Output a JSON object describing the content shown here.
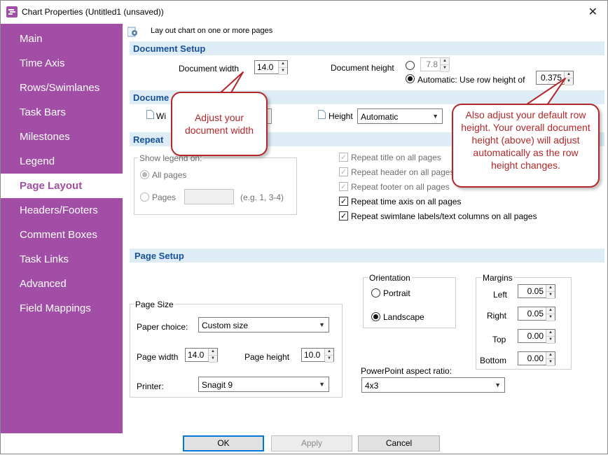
{
  "window": {
    "title": "Chart Properties (Untitled1 (unsaved))",
    "close_label": "✕"
  },
  "sidebar": {
    "items": [
      {
        "label": "Main"
      },
      {
        "label": "Time Axis"
      },
      {
        "label": "Rows/Swimlanes"
      },
      {
        "label": "Task Bars"
      },
      {
        "label": "Milestones"
      },
      {
        "label": "Legend"
      },
      {
        "label": "Page Layout"
      },
      {
        "label": "Headers/Footers"
      },
      {
        "label": "Comment Boxes"
      },
      {
        "label": "Task Links"
      },
      {
        "label": "Advanced"
      },
      {
        "label": "Field Mappings"
      }
    ],
    "active": "Page Layout"
  },
  "header": {
    "description": "Lay out chart on one or more pages"
  },
  "document_setup": {
    "title": "Document Setup",
    "width_label": "Document width",
    "width_value": "14.0",
    "height_label": "Document height",
    "height_value": "7.8",
    "auto_label": "Automatic: Use row height of",
    "row_height_value": "0.375"
  },
  "document_section": {
    "title_visible": "Docume",
    "width_label_visible": "Wi",
    "height_label": "Height",
    "height_select": "Automatic"
  },
  "repeat_section": {
    "title_visible": "Repeat",
    "show_legend_label": "Show legend on:",
    "all_pages_label": "All pages",
    "pages_label": "Pages",
    "pages_hint": "(e.g. 1, 3-4)",
    "options": [
      {
        "label": "Repeat title on all pages",
        "checked": true,
        "disabled": true
      },
      {
        "label": "Repeat header on all pages",
        "checked": true,
        "disabled": true
      },
      {
        "label": "Repeat footer on all pages",
        "checked": true,
        "disabled": true
      },
      {
        "label": "Repeat time axis on all pages",
        "checked": true,
        "disabled": false
      },
      {
        "label": "Repeat swimlane labels/text columns on all pages",
        "checked": true,
        "disabled": false
      }
    ]
  },
  "page_setup": {
    "title": "Page Setup",
    "page_size_title": "Page Size",
    "paper_choice_label": "Paper choice:",
    "paper_choice_value": "Custom size",
    "page_width_label": "Page width",
    "page_width_value": "14.0",
    "page_height_label": "Page height",
    "page_height_value": "10.0",
    "printer_label": "Printer:",
    "printer_value": "Snagit 9",
    "orientation_title": "Orientation",
    "portrait_label": "Portrait",
    "landscape_label": "Landscape",
    "margins_title": "Margins",
    "margins": [
      {
        "label": "Left",
        "value": "0.05"
      },
      {
        "label": "Right",
        "value": "0.05"
      },
      {
        "label": "Top",
        "value": "0.00"
      },
      {
        "label": "Bottom",
        "value": "0.00"
      }
    ],
    "ppt_label": "PowerPoint aspect ratio:",
    "ppt_value": "4x3"
  },
  "callouts": {
    "width_note": "Adjust your document width",
    "height_note": "Also adjust your default row height. Your overall document height (above) will adjust automatically as the row height changes."
  },
  "footer": {
    "ok": "OK",
    "apply": "Apply",
    "cancel": "Cancel"
  },
  "colors": {
    "sidebar": "#a24ea6",
    "section_title": "#17509a",
    "section_band": "#deecf5",
    "callout": "#b3272a"
  }
}
